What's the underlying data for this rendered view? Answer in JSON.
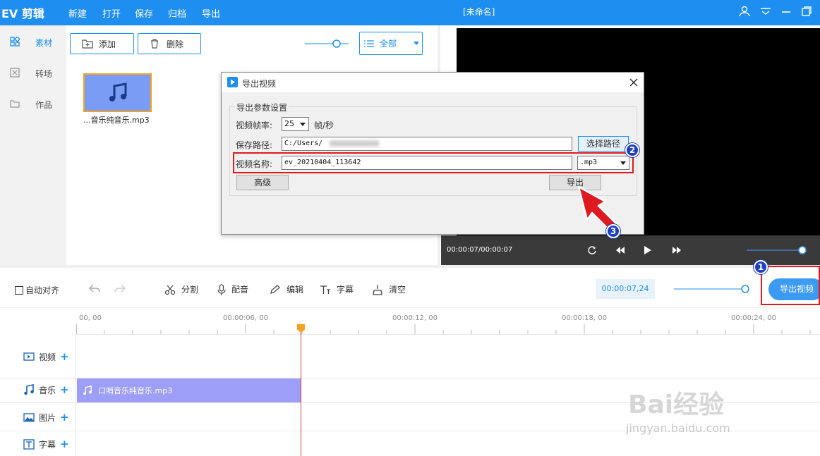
{
  "app": {
    "title": "EV 剪辑",
    "window_title": "[未命名]"
  },
  "menu": [
    "新建",
    "打开",
    "保存",
    "归档",
    "导出"
  ],
  "nav": [
    {
      "label": "素材",
      "icon": "grid-icon",
      "active": true
    },
    {
      "label": "转场",
      "icon": "transition-icon",
      "active": false
    },
    {
      "label": "作品",
      "icon": "folder-icon",
      "active": false
    }
  ],
  "media": {
    "add_label": "添加",
    "delete_label": "删除",
    "filter_label": "全部",
    "items": [
      {
        "label": "...音乐纯音乐.mp3",
        "icon": "music-note-icon"
      }
    ]
  },
  "preview": {
    "timecode": "00:00:07/00:00:07"
  },
  "toolbar": {
    "auto_align": "自动对齐",
    "split": "分割",
    "dub": "配音",
    "edit": "编辑",
    "subtitle": "字幕",
    "clear": "清空",
    "time": "00:00:07,24",
    "export_video": "导出视频"
  },
  "timeline": {
    "ticks": [
      "00, 00",
      "00:00:06, 00",
      "00:00:12, 00",
      "00:00:18, 00",
      "00:00:24, 00"
    ],
    "tracks": [
      {
        "label": "视频",
        "icon": "video-icon"
      },
      {
        "label": "音乐",
        "icon": "music-note-icon"
      },
      {
        "label": "图片",
        "icon": "image-icon"
      },
      {
        "label": "字幕",
        "icon": "text-icon"
      }
    ],
    "music_clip": "口哨音乐纯音乐.mp3"
  },
  "dialog": {
    "title": "导出视频",
    "group_title": "导出参数设置",
    "fps_label": "视频帧率:",
    "fps_value": "25",
    "fps_unit": "帧/秒",
    "path_label": "保存路径:",
    "path_value": "C:/Users/",
    "choose_path": "选择路径",
    "name_label": "视频名称:",
    "name_value": "ev_20210404_113642",
    "format_value": ".mp3",
    "advanced": "高级",
    "export": "导出"
  },
  "annotations": {
    "badge1": "1",
    "badge2": "2",
    "badge3": "3"
  },
  "watermark": {
    "main": "Bai经验",
    "sub": "jingyan.baidu.com"
  },
  "colors": {
    "primary": "#1f8ef1",
    "highlight": "#e0191f",
    "clip": "#9c9ef7",
    "playhead": "#e0353d"
  }
}
